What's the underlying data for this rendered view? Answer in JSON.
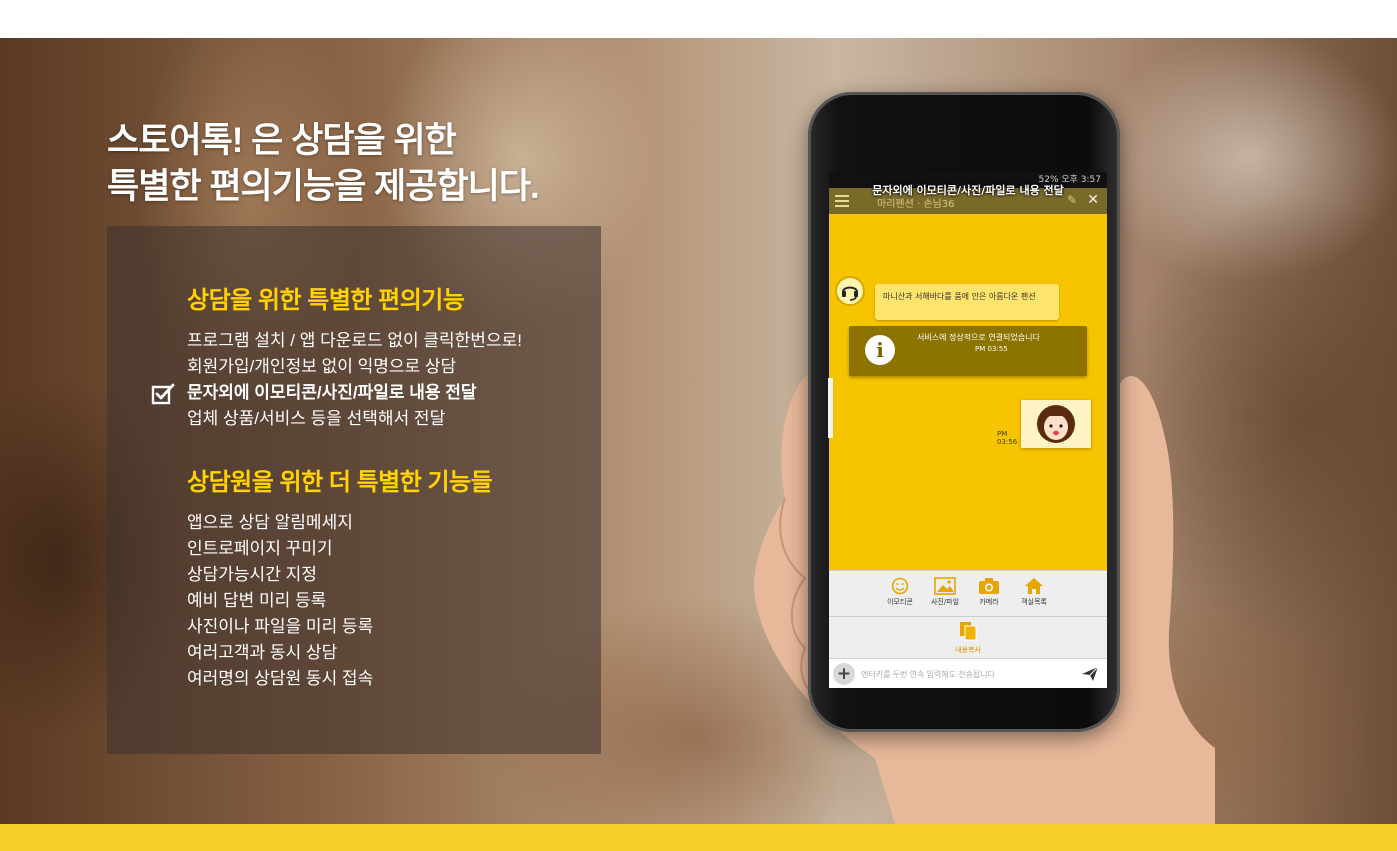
{
  "hero": {
    "title_line1": "스토어톡! 은 상담을 위한",
    "title_line2": "특별한 편의기능을 제공합니다."
  },
  "section1": {
    "title": "상담을 위한 특별한 편의기능",
    "items": [
      "프로그램 설치 / 앱 다운로드 없이 클릭한번으로!",
      "회원가입/개인정보 없이 익명으로 상담",
      "문자외에 이모티콘/사진/파일로 내용 전달",
      "업체 상품/서비스 등을 선택해서 전달"
    ],
    "highlight_index": 2
  },
  "section2": {
    "title": "상담원을 위한 더 특별한 기능들",
    "items": [
      "앱으로 상담 알림메세지",
      "인트로페이지 꾸미기",
      "상담가능시간 지정",
      "예비 답변 미리 등록",
      "사진이나 파일을 미리 등록",
      "여러고객과 동시 상담",
      "여러명의 상담원 동시 접속"
    ]
  },
  "phone": {
    "status": "52% 오후 3:57",
    "caption": "문자외에 이모티콘/사진/파일로 내용 전달",
    "header_title": "마리펜션 · 손님36",
    "greeting": "마니산과 서해바다를 품에 안은 아름다운 펜션",
    "notice_text": "서비스에 정상적으로 연결되었습니다",
    "notice_time": "PM 03:55",
    "sent_time": "PM 03:56",
    "tools": [
      "이모티콘",
      "사진/파일",
      "카메라",
      "객실목록"
    ],
    "copy_label": "내용복사",
    "input_placeholder": "엔터키를 두번 연속 입력해도 전송됩니다"
  },
  "colors": {
    "accent_yellow": "#ffd200",
    "chat_background": "#f6c400",
    "bottom_band": "#f5cf2a"
  }
}
